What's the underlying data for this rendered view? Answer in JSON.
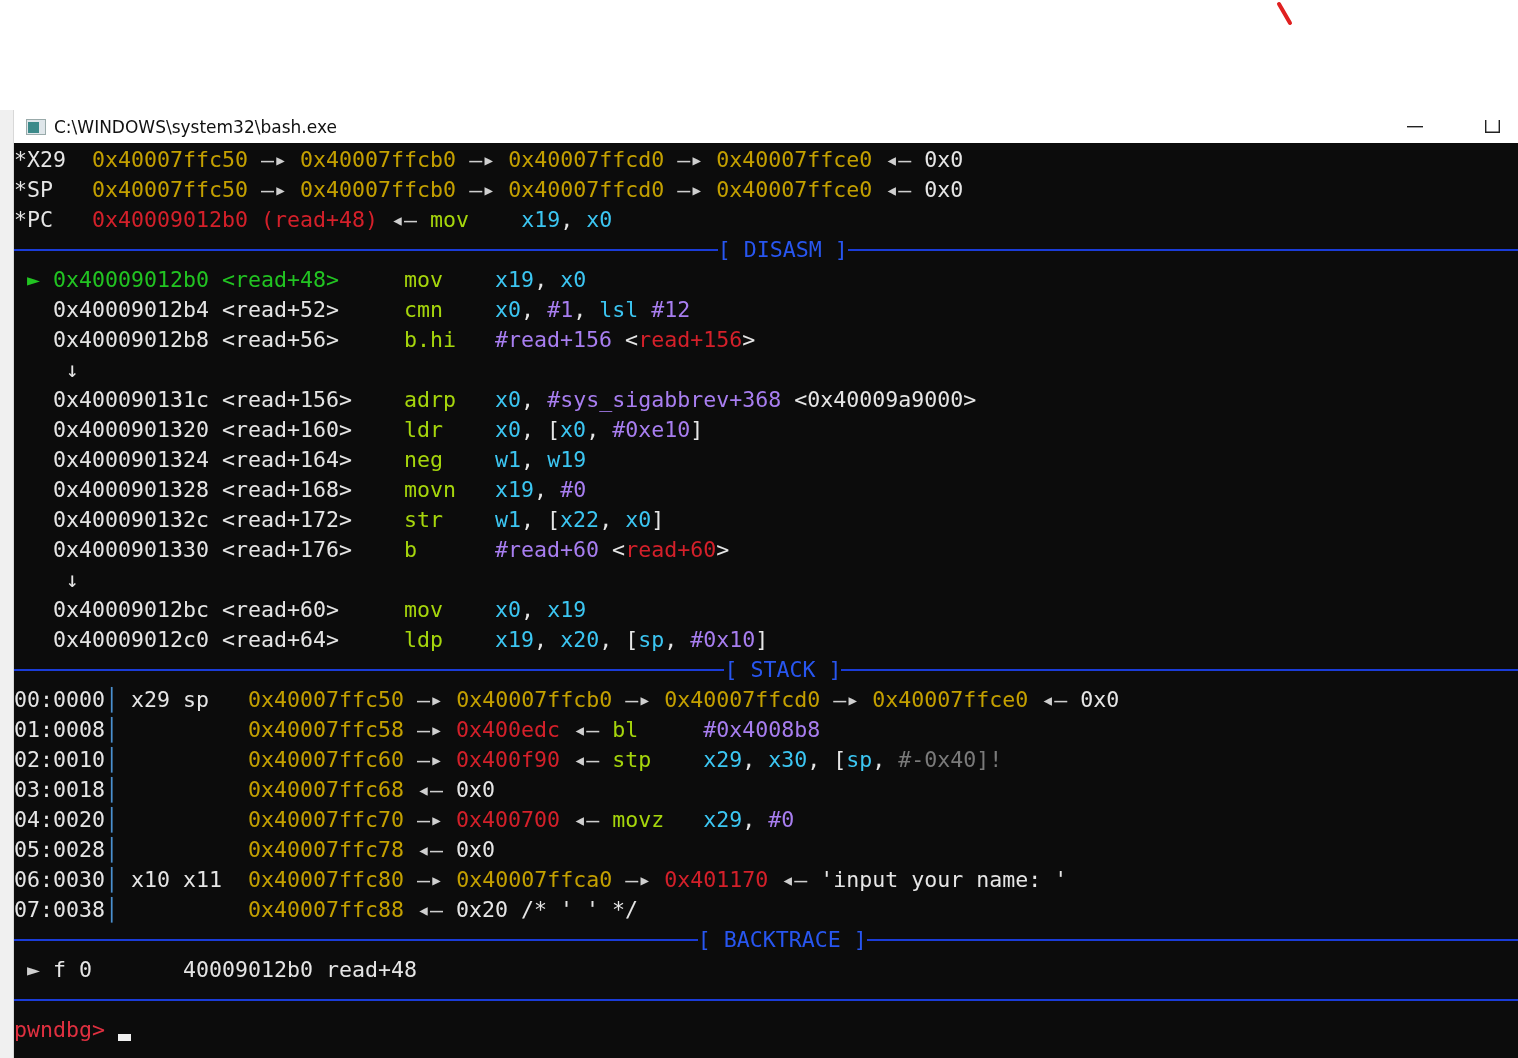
{
  "window": {
    "title": "C:\\WINDOWS\\system32\\bash.exe"
  },
  "terminal": {
    "lines": [
      {
        "kind": "text",
        "parts": [
          {
            "text": "*X29",
            "color": "#e6e6e6"
          },
          {
            "text": "  0x40007ffc50",
            "color": "#c4a000"
          },
          {
            "text": " —▸",
            "color": "#cfcfcf"
          },
          {
            "text": " 0x40007ffcb0",
            "color": "#c4a000"
          },
          {
            "text": " —▸",
            "color": "#cfcfcf"
          },
          {
            "text": " 0x40007ffcd0",
            "color": "#c4a000"
          },
          {
            "text": " —▸",
            "color": "#cfcfcf"
          },
          {
            "text": " 0x40007ffce0",
            "color": "#c4a000"
          },
          {
            "text": " ◂—",
            "color": "#cfcfcf"
          },
          {
            "text": " 0x0",
            "color": "#e6e6e6"
          }
        ]
      },
      {
        "kind": "text",
        "parts": [
          {
            "text": "*SP",
            "color": "#e6e6e6"
          },
          {
            "text": "   0x40007ffc50",
            "color": "#c4a000"
          },
          {
            "text": " —▸",
            "color": "#cfcfcf"
          },
          {
            "text": " 0x40007ffcb0",
            "color": "#c4a000"
          },
          {
            "text": " —▸",
            "color": "#cfcfcf"
          },
          {
            "text": " 0x40007ffcd0",
            "color": "#c4a000"
          },
          {
            "text": " —▸",
            "color": "#cfcfcf"
          },
          {
            "text": " 0x40007ffce0",
            "color": "#c4a000"
          },
          {
            "text": " ◂—",
            "color": "#cfcfcf"
          },
          {
            "text": " 0x0",
            "color": "#e6e6e6"
          }
        ]
      },
      {
        "kind": "text",
        "parts": [
          {
            "text": "*PC",
            "color": "#e6e6e6"
          },
          {
            "text": "   0x40009012b0 (read+48)",
            "color": "#d4202a"
          },
          {
            "text": " ◂—",
            "color": "#cfcfcf"
          },
          {
            "text": " mov",
            "color": "#a6d60c"
          },
          {
            "text": "    x19",
            "color": "#3cc6f2"
          },
          {
            "text": ",",
            "color": "#e6e6e6"
          },
          {
            "text": " x0",
            "color": "#3cc6f2"
          }
        ]
      },
      {
        "kind": "rule",
        "title": "[ DISASM ]"
      },
      {
        "kind": "text",
        "parts": [
          {
            "text": " ►",
            "color": "#22c422"
          },
          {
            "text": " 0x40009012b0 <read+48>",
            "color": "#22c422"
          },
          {
            "text": "     mov",
            "color": "#a6d60c"
          },
          {
            "text": "    x19",
            "color": "#3cc6f2"
          },
          {
            "text": ",",
            "color": "#e6e6e6"
          },
          {
            "text": " x0",
            "color": "#3cc6f2"
          }
        ]
      },
      {
        "kind": "text",
        "parts": [
          {
            "text": "   0x40009012b4 <read+52>",
            "color": "#e6e6e6"
          },
          {
            "text": "     cmn",
            "color": "#a6d60c"
          },
          {
            "text": "    x0",
            "color": "#3cc6f2"
          },
          {
            "text": ",",
            "color": "#e6e6e6"
          },
          {
            "text": " #1",
            "color": "#a87ef0"
          },
          {
            "text": ",",
            "color": "#e6e6e6"
          },
          {
            "text": " lsl",
            "color": "#3cc6f2"
          },
          {
            "text": " #12",
            "color": "#a87ef0"
          }
        ]
      },
      {
        "kind": "text",
        "parts": [
          {
            "text": "   0x40009012b8 <read+56>",
            "color": "#e6e6e6"
          },
          {
            "text": "     b.hi",
            "color": "#a6d60c"
          },
          {
            "text": "   #read+156",
            "color": "#a87ef0"
          },
          {
            "text": " <",
            "color": "#e6e6e6"
          },
          {
            "text": "read+156",
            "color": "#d4202a"
          },
          {
            "text": ">",
            "color": "#e6e6e6"
          }
        ]
      },
      {
        "kind": "text",
        "parts": [
          {
            "text": "    ↓",
            "color": "#e6e6e6"
          }
        ]
      },
      {
        "kind": "text",
        "parts": [
          {
            "text": "   0x400090131c <read+156>",
            "color": "#e6e6e6"
          },
          {
            "text": "    adrp",
            "color": "#a6d60c"
          },
          {
            "text": "   x0",
            "color": "#3cc6f2"
          },
          {
            "text": ",",
            "color": "#e6e6e6"
          },
          {
            "text": " #sys_sigabbrev+368",
            "color": "#a87ef0"
          },
          {
            "text": " <0x40009a9000>",
            "color": "#e6e6e6"
          }
        ]
      },
      {
        "kind": "text",
        "parts": [
          {
            "text": "   0x4000901320 <read+160>",
            "color": "#e6e6e6"
          },
          {
            "text": "    ldr",
            "color": "#a6d60c"
          },
          {
            "text": "    x0",
            "color": "#3cc6f2"
          },
          {
            "text": ", [",
            "color": "#e6e6e6"
          },
          {
            "text": "x0",
            "color": "#3cc6f2"
          },
          {
            "text": ",",
            "color": "#e6e6e6"
          },
          {
            "text": " #0xe10",
            "color": "#a87ef0"
          },
          {
            "text": "]",
            "color": "#e6e6e6"
          }
        ]
      },
      {
        "kind": "text",
        "parts": [
          {
            "text": "   0x4000901324 <read+164>",
            "color": "#e6e6e6"
          },
          {
            "text": "    neg",
            "color": "#a6d60c"
          },
          {
            "text": "    w1",
            "color": "#3cc6f2"
          },
          {
            "text": ",",
            "color": "#e6e6e6"
          },
          {
            "text": " w19",
            "color": "#3cc6f2"
          }
        ]
      },
      {
        "kind": "text",
        "parts": [
          {
            "text": "   0x4000901328 <read+168>",
            "color": "#e6e6e6"
          },
          {
            "text": "    movn",
            "color": "#a6d60c"
          },
          {
            "text": "   x19",
            "color": "#3cc6f2"
          },
          {
            "text": ",",
            "color": "#e6e6e6"
          },
          {
            "text": " #0",
            "color": "#a87ef0"
          }
        ]
      },
      {
        "kind": "text",
        "parts": [
          {
            "text": "   0x400090132c <read+172>",
            "color": "#e6e6e6"
          },
          {
            "text": "    str",
            "color": "#a6d60c"
          },
          {
            "text": "    w1",
            "color": "#3cc6f2"
          },
          {
            "text": ", [",
            "color": "#e6e6e6"
          },
          {
            "text": "x22",
            "color": "#3cc6f2"
          },
          {
            "text": ",",
            "color": "#e6e6e6"
          },
          {
            "text": " x0",
            "color": "#3cc6f2"
          },
          {
            "text": "]",
            "color": "#e6e6e6"
          }
        ]
      },
      {
        "kind": "text",
        "parts": [
          {
            "text": "   0x4000901330 <read+176>",
            "color": "#e6e6e6"
          },
          {
            "text": "    b",
            "color": "#a6d60c"
          },
          {
            "text": "      #read+60",
            "color": "#a87ef0"
          },
          {
            "text": " <",
            "color": "#e6e6e6"
          },
          {
            "text": "read+60",
            "color": "#d4202a"
          },
          {
            "text": ">",
            "color": "#e6e6e6"
          }
        ]
      },
      {
        "kind": "text",
        "parts": [
          {
            "text": "    ↓",
            "color": "#e6e6e6"
          }
        ]
      },
      {
        "kind": "text",
        "parts": [
          {
            "text": "   0x40009012bc <read+60>",
            "color": "#e6e6e6"
          },
          {
            "text": "     mov",
            "color": "#a6d60c"
          },
          {
            "text": "    x0",
            "color": "#3cc6f2"
          },
          {
            "text": ",",
            "color": "#e6e6e6"
          },
          {
            "text": " x19",
            "color": "#3cc6f2"
          }
        ]
      },
      {
        "kind": "text",
        "parts": [
          {
            "text": "   0x40009012c0 <read+64>",
            "color": "#e6e6e6"
          },
          {
            "text": "     ldp",
            "color": "#a6d60c"
          },
          {
            "text": "    x19",
            "color": "#3cc6f2"
          },
          {
            "text": ",",
            "color": "#e6e6e6"
          },
          {
            "text": " x20",
            "color": "#3cc6f2"
          },
          {
            "text": ", [",
            "color": "#e6e6e6"
          },
          {
            "text": "sp",
            "color": "#3cc6f2"
          },
          {
            "text": ",",
            "color": "#e6e6e6"
          },
          {
            "text": " #0x10",
            "color": "#a87ef0"
          },
          {
            "text": "]",
            "color": "#e6e6e6"
          }
        ]
      },
      {
        "kind": "rule",
        "title": "[ STACK ]"
      },
      {
        "kind": "text",
        "parts": [
          {
            "text": "00:0000",
            "color": "#e6e6e6"
          },
          {
            "text": "│",
            "color": "#4a90d0"
          },
          {
            "text": " x29 sp",
            "color": "#e6e6e6"
          },
          {
            "text": "   0x40007ffc50",
            "color": "#c4a000"
          },
          {
            "text": " —▸",
            "color": "#cfcfcf"
          },
          {
            "text": " 0x40007ffcb0",
            "color": "#c4a000"
          },
          {
            "text": " —▸",
            "color": "#cfcfcf"
          },
          {
            "text": " 0x40007ffcd0",
            "color": "#c4a000"
          },
          {
            "text": " —▸",
            "color": "#cfcfcf"
          },
          {
            "text": " 0x40007ffce0",
            "color": "#c4a000"
          },
          {
            "text": " ◂—",
            "color": "#cfcfcf"
          },
          {
            "text": " 0x0",
            "color": "#e6e6e6"
          }
        ]
      },
      {
        "kind": "text",
        "parts": [
          {
            "text": "01:0008",
            "color": "#e6e6e6"
          },
          {
            "text": "│",
            "color": "#4a90d0"
          },
          {
            "text": "          0x40007ffc58",
            "color": "#c4a000"
          },
          {
            "text": " —▸",
            "color": "#cfcfcf"
          },
          {
            "text": " 0x400edc",
            "color": "#d4202a"
          },
          {
            "text": " ◂—",
            "color": "#cfcfcf"
          },
          {
            "text": " bl",
            "color": "#a6d60c"
          },
          {
            "text": "     #0x4008b8",
            "color": "#a87ef0"
          }
        ]
      },
      {
        "kind": "text",
        "parts": [
          {
            "text": "02:0010",
            "color": "#e6e6e6"
          },
          {
            "text": "│",
            "color": "#4a90d0"
          },
          {
            "text": "          0x40007ffc60",
            "color": "#c4a000"
          },
          {
            "text": " —▸",
            "color": "#cfcfcf"
          },
          {
            "text": " 0x400f90",
            "color": "#d4202a"
          },
          {
            "text": " ◂—",
            "color": "#cfcfcf"
          },
          {
            "text": " stp",
            "color": "#a6d60c"
          },
          {
            "text": "    x29",
            "color": "#3cc6f2"
          },
          {
            "text": ",",
            "color": "#e6e6e6"
          },
          {
            "text": " x30",
            "color": "#3cc6f2"
          },
          {
            "text": ", [",
            "color": "#e6e6e6"
          },
          {
            "text": "sp",
            "color": "#3cc6f2"
          },
          {
            "text": ",",
            "color": "#e6e6e6"
          },
          {
            "text": " #-0x40]!",
            "color": "#7a7a7a"
          }
        ]
      },
      {
        "kind": "text",
        "parts": [
          {
            "text": "03:0018",
            "color": "#e6e6e6"
          },
          {
            "text": "│",
            "color": "#4a90d0"
          },
          {
            "text": "          0x40007ffc68",
            "color": "#c4a000"
          },
          {
            "text": " ◂—",
            "color": "#cfcfcf"
          },
          {
            "text": " 0x0",
            "color": "#e6e6e6"
          }
        ]
      },
      {
        "kind": "text",
        "parts": [
          {
            "text": "04:0020",
            "color": "#e6e6e6"
          },
          {
            "text": "│",
            "color": "#4a90d0"
          },
          {
            "text": "          0x40007ffc70",
            "color": "#c4a000"
          },
          {
            "text": " —▸",
            "color": "#cfcfcf"
          },
          {
            "text": " 0x400700",
            "color": "#d4202a"
          },
          {
            "text": " ◂—",
            "color": "#cfcfcf"
          },
          {
            "text": " movz",
            "color": "#a6d60c"
          },
          {
            "text": "   x29",
            "color": "#3cc6f2"
          },
          {
            "text": ",",
            "color": "#e6e6e6"
          },
          {
            "text": " #0",
            "color": "#a87ef0"
          }
        ]
      },
      {
        "kind": "text",
        "parts": [
          {
            "text": "05:0028",
            "color": "#e6e6e6"
          },
          {
            "text": "│",
            "color": "#4a90d0"
          },
          {
            "text": "          0x40007ffc78",
            "color": "#c4a000"
          },
          {
            "text": " ◂—",
            "color": "#cfcfcf"
          },
          {
            "text": " 0x0",
            "color": "#e6e6e6"
          }
        ]
      },
      {
        "kind": "text",
        "parts": [
          {
            "text": "06:0030",
            "color": "#e6e6e6"
          },
          {
            "text": "│",
            "color": "#4a90d0"
          },
          {
            "text": " x10 x11",
            "color": "#e6e6e6"
          },
          {
            "text": "  0x40007ffc80",
            "color": "#c4a000"
          },
          {
            "text": " —▸",
            "color": "#cfcfcf"
          },
          {
            "text": " 0x40007ffca0",
            "color": "#c4a000"
          },
          {
            "text": " —▸",
            "color": "#cfcfcf"
          },
          {
            "text": " 0x401170",
            "color": "#d4202a"
          },
          {
            "text": " ◂—",
            "color": "#cfcfcf"
          },
          {
            "text": " 'input your name: '",
            "color": "#e6e6e6"
          }
        ]
      },
      {
        "kind": "text",
        "parts": [
          {
            "text": "07:0038",
            "color": "#e6e6e6"
          },
          {
            "text": "│",
            "color": "#4a90d0"
          },
          {
            "text": "          0x40007ffc88",
            "color": "#c4a000"
          },
          {
            "text": " ◂—",
            "color": "#cfcfcf"
          },
          {
            "text": " 0x20 /* ' ' */",
            "color": "#e6e6e6"
          }
        ]
      },
      {
        "kind": "rule",
        "title": "[ BACKTRACE ]"
      },
      {
        "kind": "text",
        "parts": [
          {
            "text": " ►",
            "color": "#cfcfcf"
          },
          {
            "text": " f 0",
            "color": "#e6e6e6"
          },
          {
            "text": "       40009012b0 read+48",
            "color": "#e6e6e6"
          }
        ]
      },
      {
        "kind": "rule"
      },
      {
        "kind": "prompt",
        "parts": [
          {
            "text": "pwndbg>",
            "color": "#e03040"
          }
        ]
      }
    ]
  }
}
